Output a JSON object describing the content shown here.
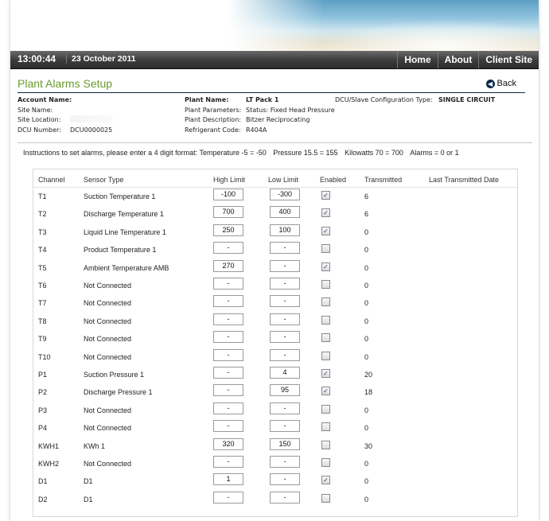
{
  "navbar": {
    "time": "13:00:44",
    "date": "23 October 2011",
    "links": [
      "Home",
      "About",
      "Client Site"
    ]
  },
  "page": {
    "title": "Plant Alarms Setup",
    "back_label": "Back"
  },
  "plant_info": {
    "account_name_label": "Account Name:",
    "account_name": "",
    "site_name_label": "Site Name:",
    "site_name": "",
    "site_location_label": "Site Location:",
    "site_location": "",
    "dcu_number_label": "DCU Number:",
    "dcu_number": "DCU0000025",
    "plant_name_label": "Plant Name:",
    "plant_name": "LT Pack 1",
    "plant_parameters_label": "Plant Parameters:",
    "plant_parameters": "Status: Fixed Head Pressure",
    "plant_description_label": "Plant Description:",
    "plant_description": "Bitzer Reciprocating",
    "refrigerant_code_label": "Refrigerant Code:",
    "refrigerant_code": "R404A",
    "dcu_config_label": "DCU/Slave Configuration Type:",
    "dcu_config": "SINGLE CIRCUIT"
  },
  "instructions": {
    "lead": "Instructions to set alarms, please enter a 4 digit format: Temperature -5 = -50",
    "pressure": "Pressure 15.5 = 155",
    "kilowatts": "Kilowatts 70 = 700",
    "alarms": "Alarms = 0 or 1"
  },
  "table": {
    "headers": {
      "channel": "Channel",
      "sensor_type": "Sensor Type",
      "high_limit": "High Limit",
      "low_limit": "Low Limit",
      "enabled": "Enabled",
      "transmitted": "Transmitted",
      "last_date": "Last Transmitted Date"
    },
    "rows": [
      {
        "channel": "T1",
        "sensor": "Suction Temperature 1",
        "high": "-100",
        "low": "-300",
        "enabled": true,
        "transmitted": "6",
        "last": ""
      },
      {
        "channel": "T2",
        "sensor": "Discharge Temperature 1",
        "high": "700",
        "low": "400",
        "enabled": true,
        "transmitted": "6",
        "last": ""
      },
      {
        "channel": "T3",
        "sensor": "Liquid Line Temperature 1",
        "high": "250",
        "low": "100",
        "enabled": true,
        "transmitted": "0",
        "last": ""
      },
      {
        "channel": "T4",
        "sensor": "Product Temperature 1",
        "high": "-",
        "low": "-",
        "enabled": false,
        "transmitted": "0",
        "last": ""
      },
      {
        "channel": "T5",
        "sensor": "Ambient Temperature AMB",
        "high": "270",
        "low": "-",
        "enabled": true,
        "transmitted": "0",
        "last": ""
      },
      {
        "channel": "T6",
        "sensor": "Not Connected",
        "high": "-",
        "low": "-",
        "enabled": false,
        "transmitted": "0",
        "last": ""
      },
      {
        "channel": "T7",
        "sensor": "Not Connected",
        "high": "-",
        "low": "-",
        "enabled": false,
        "transmitted": "0",
        "last": ""
      },
      {
        "channel": "T8",
        "sensor": "Not Connected",
        "high": "-",
        "low": "-",
        "enabled": false,
        "transmitted": "0",
        "last": ""
      },
      {
        "channel": "T9",
        "sensor": "Not Connected",
        "high": "-",
        "low": "-",
        "enabled": false,
        "transmitted": "0",
        "last": ""
      },
      {
        "channel": "T10",
        "sensor": "Not Connected",
        "high": "-",
        "low": "-",
        "enabled": false,
        "transmitted": "0",
        "last": ""
      },
      {
        "channel": "P1",
        "sensor": "Suction Pressure 1",
        "high": "-",
        "low": "4",
        "enabled": true,
        "transmitted": "20",
        "last": ""
      },
      {
        "channel": "P2",
        "sensor": "Discharge Pressure 1",
        "high": "-",
        "low": "95",
        "enabled": true,
        "transmitted": "18",
        "last": ""
      },
      {
        "channel": "P3",
        "sensor": "Not Connected",
        "high": "-",
        "low": "-",
        "enabled": false,
        "transmitted": "0",
        "last": ""
      },
      {
        "channel": "P4",
        "sensor": "Not Connected",
        "high": "-",
        "low": "-",
        "enabled": false,
        "transmitted": "0",
        "last": ""
      },
      {
        "channel": "KWH1",
        "sensor": "KWh 1",
        "high": "320",
        "low": "150",
        "enabled": false,
        "transmitted": "30",
        "last": ""
      },
      {
        "channel": "KWH2",
        "sensor": "Not Connected",
        "high": "-",
        "low": "-",
        "enabled": false,
        "transmitted": "0",
        "last": ""
      },
      {
        "channel": "D1",
        "sensor": "D1",
        "high": "1",
        "low": "-",
        "enabled": true,
        "transmitted": "0",
        "last": ""
      },
      {
        "channel": "D2",
        "sensor": "D1",
        "high": "-",
        "low": "-",
        "enabled": false,
        "transmitted": "0",
        "last": ""
      }
    ]
  },
  "colors": {
    "title_green": "#6b9a2e",
    "rule_navy": "#0b2a4a",
    "navbar_dark": "#3e3e3e",
    "check_blue": "#1d3f8a"
  },
  "icons": {
    "back": "circle-left-arrow-icon",
    "checked": "check-icon"
  }
}
